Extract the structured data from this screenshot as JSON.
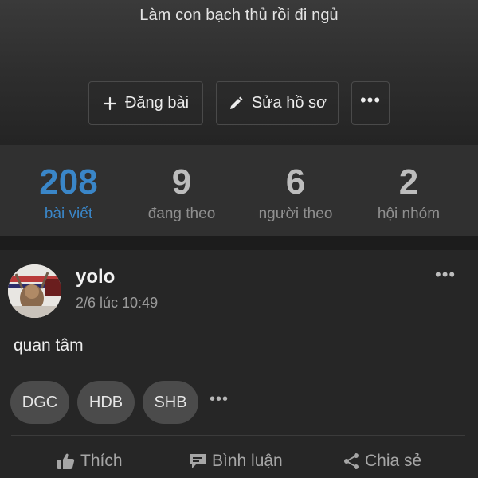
{
  "profile": {
    "bio": "Làm con bạch thủ rồi đi ngủ",
    "actions": {
      "post_label": "Đăng bài",
      "edit_label": "Sửa hồ sơ",
      "more_label": "•••"
    }
  },
  "stats": [
    {
      "value": "208",
      "label": "bài viết",
      "active": true
    },
    {
      "value": "9",
      "label": "đang theo",
      "active": false
    },
    {
      "value": "6",
      "label": "người theo",
      "active": false
    },
    {
      "value": "2",
      "label": "hội nhóm",
      "active": false
    }
  ],
  "post": {
    "author": "yolo",
    "time": "2/6 lúc 10:49",
    "more_label": "•••",
    "text": "quan tâm",
    "tags": [
      "DGC",
      "HDB",
      "SHB"
    ],
    "tags_more": "•••",
    "actions": {
      "like": "Thích",
      "comment": "Bình luận",
      "share": "Chia sẻ"
    }
  },
  "colors": {
    "accent": "#3a86c8",
    "background": "#242424",
    "stats_bg": "#303030",
    "tag_bg": "#4b4b4b"
  },
  "icons": [
    "plus-icon",
    "pencil-icon",
    "more-icon",
    "thumbs-up-icon",
    "comment-icon",
    "share-icon"
  ]
}
